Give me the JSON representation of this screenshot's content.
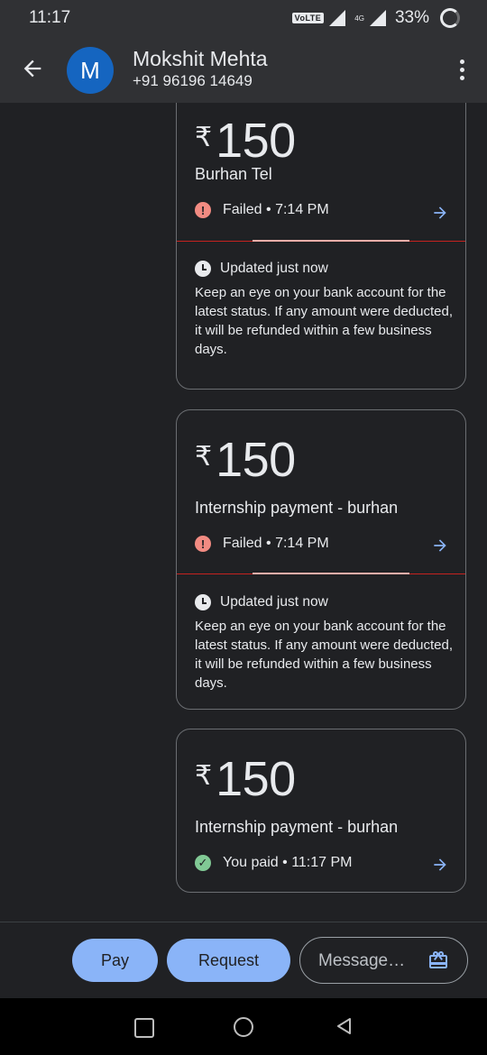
{
  "status_bar": {
    "time": "11:17",
    "network_badge": "VoLTE",
    "network_type": "4G",
    "battery": "33%"
  },
  "header": {
    "avatar_initial": "M",
    "contact_name": "Mokshit Mehta",
    "contact_phone": "+91 96196 14649"
  },
  "transactions": [
    {
      "currency": "₹",
      "amount": "150",
      "description": "Burhan Tel",
      "status_text": "Failed • 7:14 PM",
      "status": "failed",
      "updated_text": "Updated just now",
      "note": "Keep an eye on your bank account for the latest status. If any amount were deducted, it will be refunded within a few business days."
    },
    {
      "currency": "₹",
      "amount": "150",
      "description": "Internship payment - burhan",
      "status_text": "Failed • 7:14 PM",
      "status": "failed",
      "updated_text": "Updated just now",
      "note": "Keep an eye on your bank account for the latest status. If any amount were deducted, it will be refunded within a few business days."
    },
    {
      "currency": "₹",
      "amount": "150",
      "description": "Internship payment - burhan",
      "status_text": "You paid • 11:17 PM",
      "status": "success"
    }
  ],
  "actions": {
    "pay_label": "Pay",
    "request_label": "Request",
    "message_placeholder": "Message…"
  },
  "colors": {
    "accent": "#8ab4f8",
    "failed": "#f28b82",
    "success": "#81c995",
    "background": "#202124",
    "bar": "#303134"
  },
  "icons": [
    "back-arrow-icon",
    "more-vert-icon",
    "error-icon",
    "check-circle-icon",
    "arrow-right-icon",
    "clock-icon",
    "gift-icon",
    "nav-recents-icon",
    "nav-home-icon",
    "nav-back-icon"
  ]
}
